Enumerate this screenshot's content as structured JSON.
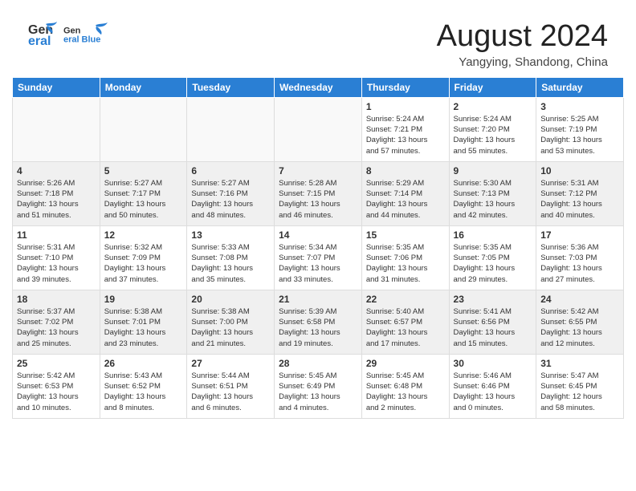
{
  "header": {
    "logo": {
      "general": "General",
      "blue": "Blue",
      "icon": "▶"
    },
    "title": "August 2024",
    "subtitle": "Yangying, Shandong, China"
  },
  "calendar": {
    "weekdays": [
      "Sunday",
      "Monday",
      "Tuesday",
      "Wednesday",
      "Thursday",
      "Friday",
      "Saturday"
    ],
    "weeks": [
      {
        "days": [
          {
            "num": "",
            "info": "",
            "empty": true
          },
          {
            "num": "",
            "info": "",
            "empty": true
          },
          {
            "num": "",
            "info": "",
            "empty": true
          },
          {
            "num": "",
            "info": "",
            "empty": true
          },
          {
            "num": "1",
            "info": "Sunrise: 5:24 AM\nSunset: 7:21 PM\nDaylight: 13 hours\nand 57 minutes."
          },
          {
            "num": "2",
            "info": "Sunrise: 5:24 AM\nSunset: 7:20 PM\nDaylight: 13 hours\nand 55 minutes."
          },
          {
            "num": "3",
            "info": "Sunrise: 5:25 AM\nSunset: 7:19 PM\nDaylight: 13 hours\nand 53 minutes."
          }
        ]
      },
      {
        "days": [
          {
            "num": "4",
            "info": "Sunrise: 5:26 AM\nSunset: 7:18 PM\nDaylight: 13 hours\nand 51 minutes."
          },
          {
            "num": "5",
            "info": "Sunrise: 5:27 AM\nSunset: 7:17 PM\nDaylight: 13 hours\nand 50 minutes."
          },
          {
            "num": "6",
            "info": "Sunrise: 5:27 AM\nSunset: 7:16 PM\nDaylight: 13 hours\nand 48 minutes."
          },
          {
            "num": "7",
            "info": "Sunrise: 5:28 AM\nSunset: 7:15 PM\nDaylight: 13 hours\nand 46 minutes."
          },
          {
            "num": "8",
            "info": "Sunrise: 5:29 AM\nSunset: 7:14 PM\nDaylight: 13 hours\nand 44 minutes."
          },
          {
            "num": "9",
            "info": "Sunrise: 5:30 AM\nSunset: 7:13 PM\nDaylight: 13 hours\nand 42 minutes."
          },
          {
            "num": "10",
            "info": "Sunrise: 5:31 AM\nSunset: 7:12 PM\nDaylight: 13 hours\nand 40 minutes."
          }
        ]
      },
      {
        "days": [
          {
            "num": "11",
            "info": "Sunrise: 5:31 AM\nSunset: 7:10 PM\nDaylight: 13 hours\nand 39 minutes."
          },
          {
            "num": "12",
            "info": "Sunrise: 5:32 AM\nSunset: 7:09 PM\nDaylight: 13 hours\nand 37 minutes."
          },
          {
            "num": "13",
            "info": "Sunrise: 5:33 AM\nSunset: 7:08 PM\nDaylight: 13 hours\nand 35 minutes."
          },
          {
            "num": "14",
            "info": "Sunrise: 5:34 AM\nSunset: 7:07 PM\nDaylight: 13 hours\nand 33 minutes."
          },
          {
            "num": "15",
            "info": "Sunrise: 5:35 AM\nSunset: 7:06 PM\nDaylight: 13 hours\nand 31 minutes."
          },
          {
            "num": "16",
            "info": "Sunrise: 5:35 AM\nSunset: 7:05 PM\nDaylight: 13 hours\nand 29 minutes."
          },
          {
            "num": "17",
            "info": "Sunrise: 5:36 AM\nSunset: 7:03 PM\nDaylight: 13 hours\nand 27 minutes."
          }
        ]
      },
      {
        "days": [
          {
            "num": "18",
            "info": "Sunrise: 5:37 AM\nSunset: 7:02 PM\nDaylight: 13 hours\nand 25 minutes."
          },
          {
            "num": "19",
            "info": "Sunrise: 5:38 AM\nSunset: 7:01 PM\nDaylight: 13 hours\nand 23 minutes."
          },
          {
            "num": "20",
            "info": "Sunrise: 5:38 AM\nSunset: 7:00 PM\nDaylight: 13 hours\nand 21 minutes."
          },
          {
            "num": "21",
            "info": "Sunrise: 5:39 AM\nSunset: 6:58 PM\nDaylight: 13 hours\nand 19 minutes."
          },
          {
            "num": "22",
            "info": "Sunrise: 5:40 AM\nSunset: 6:57 PM\nDaylight: 13 hours\nand 17 minutes."
          },
          {
            "num": "23",
            "info": "Sunrise: 5:41 AM\nSunset: 6:56 PM\nDaylight: 13 hours\nand 15 minutes."
          },
          {
            "num": "24",
            "info": "Sunrise: 5:42 AM\nSunset: 6:55 PM\nDaylight: 13 hours\nand 12 minutes."
          }
        ]
      },
      {
        "days": [
          {
            "num": "25",
            "info": "Sunrise: 5:42 AM\nSunset: 6:53 PM\nDaylight: 13 hours\nand 10 minutes."
          },
          {
            "num": "26",
            "info": "Sunrise: 5:43 AM\nSunset: 6:52 PM\nDaylight: 13 hours\nand 8 minutes."
          },
          {
            "num": "27",
            "info": "Sunrise: 5:44 AM\nSunset: 6:51 PM\nDaylight: 13 hours\nand 6 minutes."
          },
          {
            "num": "28",
            "info": "Sunrise: 5:45 AM\nSunset: 6:49 PM\nDaylight: 13 hours\nand 4 minutes."
          },
          {
            "num": "29",
            "info": "Sunrise: 5:45 AM\nSunset: 6:48 PM\nDaylight: 13 hours\nand 2 minutes."
          },
          {
            "num": "30",
            "info": "Sunrise: 5:46 AM\nSunset: 6:46 PM\nDaylight: 13 hours\nand 0 minutes."
          },
          {
            "num": "31",
            "info": "Sunrise: 5:47 AM\nSunset: 6:45 PM\nDaylight: 12 hours\nand 58 minutes."
          }
        ]
      }
    ]
  }
}
